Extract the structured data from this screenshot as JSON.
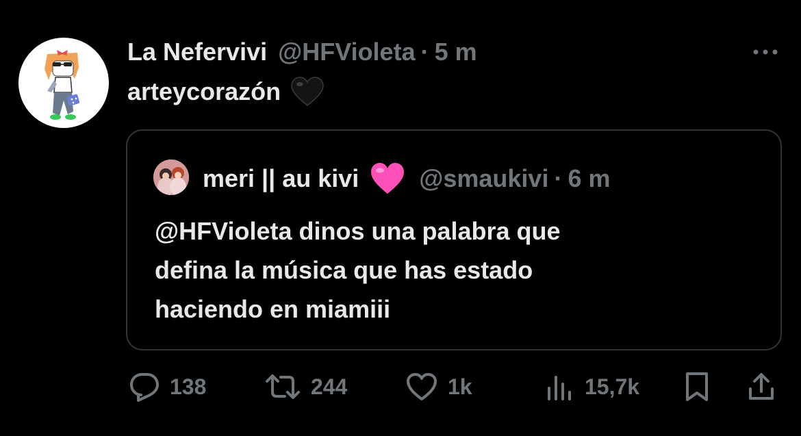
{
  "tweet": {
    "author_name": "La Nefervivi",
    "handle": "@HFVioleta",
    "separator": "·",
    "time": "5 m",
    "text": "arteycorazón",
    "emoji": "black-heart"
  },
  "quoted": {
    "author_name": "meri || au kivi",
    "emoji": "pink-heart",
    "handle": "@smaukivi",
    "separator": "·",
    "time": "6 m",
    "lines": [
      "@HFVioleta dinos una palabra que",
      "defina la música que has estado",
      "haciendo en miamiii"
    ]
  },
  "actions": {
    "replies": "138",
    "reposts": "244",
    "likes": "1k",
    "views": "15,7k"
  },
  "icons": {
    "more": "more-dots-icon",
    "reply": "reply-icon",
    "repost": "repost-icon",
    "like": "heart-icon",
    "views": "views-icon",
    "bookmark": "bookmark-icon",
    "share": "share-icon"
  },
  "colors": {
    "background": "#000000",
    "text": "#e7e9ea",
    "secondary": "#71767b",
    "border": "#2f3336",
    "pink_heart": "#ff4fb8"
  }
}
